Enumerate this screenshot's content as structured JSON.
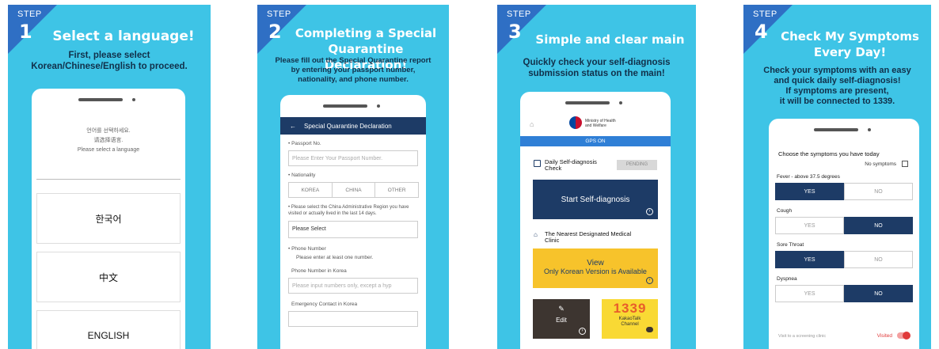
{
  "panels": [
    {
      "step_label": "STEP",
      "step_num": "1",
      "title": "Select a language!",
      "desc": [
        "First, please select",
        "Korean/Chinese/English to proceed."
      ],
      "notes": [
        "언어를 선택하세요.",
        "请选择语言.",
        "Please select a language"
      ],
      "languages": [
        "한국어",
        "中文",
        "ENGLISH"
      ]
    },
    {
      "step_label": "STEP",
      "step_num": "2",
      "title": [
        "Completing a Special",
        "Quarantine Declaration!"
      ],
      "desc": [
        "Please fill out the Special Quarantine report",
        "by entering your passport number,",
        "nationality, and phone number."
      ],
      "header": "Special Quarantine Declaration",
      "passport_label": "• Passport No.",
      "passport_ph": "Please Enter Your Passport Number.",
      "nationality_label": "• Nationality",
      "nationality_opts": [
        "KOREA",
        "CHINA",
        "OTHER"
      ],
      "region_label": "• Please select the China Administrative Region you have visited or actually lived in the last 14 days.",
      "region_value": "Please Select",
      "phone_label": "• Phone Number",
      "phone_sub": "Please enter at least one number.",
      "phone_korea_label": "Phone Number in Korea",
      "phone_korea_ph": "Please input numbers only, except a hyp",
      "emergency_label": "Emergency Contact in Korea"
    },
    {
      "step_label": "STEP",
      "step_num": "3",
      "title": "Simple and clear main",
      "desc": [
        "Quickly check your self-diagnosis",
        "submission status on the main!"
      ],
      "ministry": [
        "Ministry of Health",
        "and Welfare"
      ],
      "gps": "GPS ON",
      "daily_label": [
        "Daily Self-diagnosis",
        "Check"
      ],
      "pending": "PENDING",
      "start_btn": "Start Self-diagnosis",
      "clinic_label": [
        "The Nearest Designated Medical",
        "Clinic"
      ],
      "view_title": "View",
      "view_sub": "Only Korean Version is Available",
      "edit": "Edit",
      "kakao_num": "1339",
      "kakao_label": [
        "KakaoTalk",
        "Channel"
      ]
    },
    {
      "step_label": "STEP",
      "step_num": "4",
      "title": [
        "Check My Symptoms",
        "Every Day!"
      ],
      "desc": [
        "Check your symptoms with an easy",
        "and quick daily self-diagnosis!",
        "If symptoms are present,",
        "it will be connected to 1339."
      ],
      "choose": "Choose the symptoms you have today",
      "no_symptoms": "No symptoms",
      "yes": "YES",
      "no": "NO",
      "symptoms": [
        {
          "name": "Fever - above 37.5 degrees",
          "answer": "YES"
        },
        {
          "name": "Cough",
          "answer": "NO"
        },
        {
          "name": "Sore Throat",
          "answer": "YES"
        },
        {
          "name": "Dyspnea",
          "answer": "NO"
        }
      ],
      "visit_label": "Visit to a screening clinic",
      "visited": "Visited"
    }
  ],
  "colors": {
    "panel_bg": "#3ec4e6",
    "step_tri": "#2f6fc4",
    "navy": "#1d3b66",
    "yellow": "#f7c32b",
    "dark": "#3d3530"
  }
}
